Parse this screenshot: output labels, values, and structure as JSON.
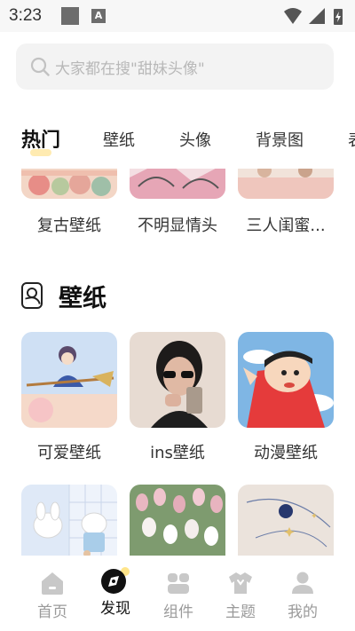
{
  "status_bar": {
    "time": "3:23",
    "a_glyph": "A"
  },
  "search": {
    "placeholder": "大家都在搜\"甜妹头像\""
  },
  "tabs": [
    {
      "label": "热门",
      "active": true
    },
    {
      "label": "壁纸",
      "active": false
    },
    {
      "label": "头像",
      "active": false
    },
    {
      "label": "背景图",
      "active": false
    },
    {
      "label": "表",
      "active": false
    }
  ],
  "top_row": [
    {
      "label": "复古壁纸"
    },
    {
      "label": "不明显情头"
    },
    {
      "label": "三人闺蜜..."
    }
  ],
  "section": {
    "title": "壁纸",
    "icon": "wallpaper-icon"
  },
  "wallpaper_row1": [
    {
      "label": "可爱壁纸"
    },
    {
      "label": "ins壁纸"
    },
    {
      "label": "动漫壁纸"
    }
  ],
  "bottom_nav": [
    {
      "label": "首页",
      "icon": "home-icon",
      "active": false
    },
    {
      "label": "发现",
      "icon": "discover-icon",
      "active": true
    },
    {
      "label": "组件",
      "icon": "widgets-icon",
      "active": false
    },
    {
      "label": "主题",
      "icon": "theme-shirt-icon",
      "active": false
    },
    {
      "label": "我的",
      "icon": "profile-icon",
      "active": false
    }
  ]
}
